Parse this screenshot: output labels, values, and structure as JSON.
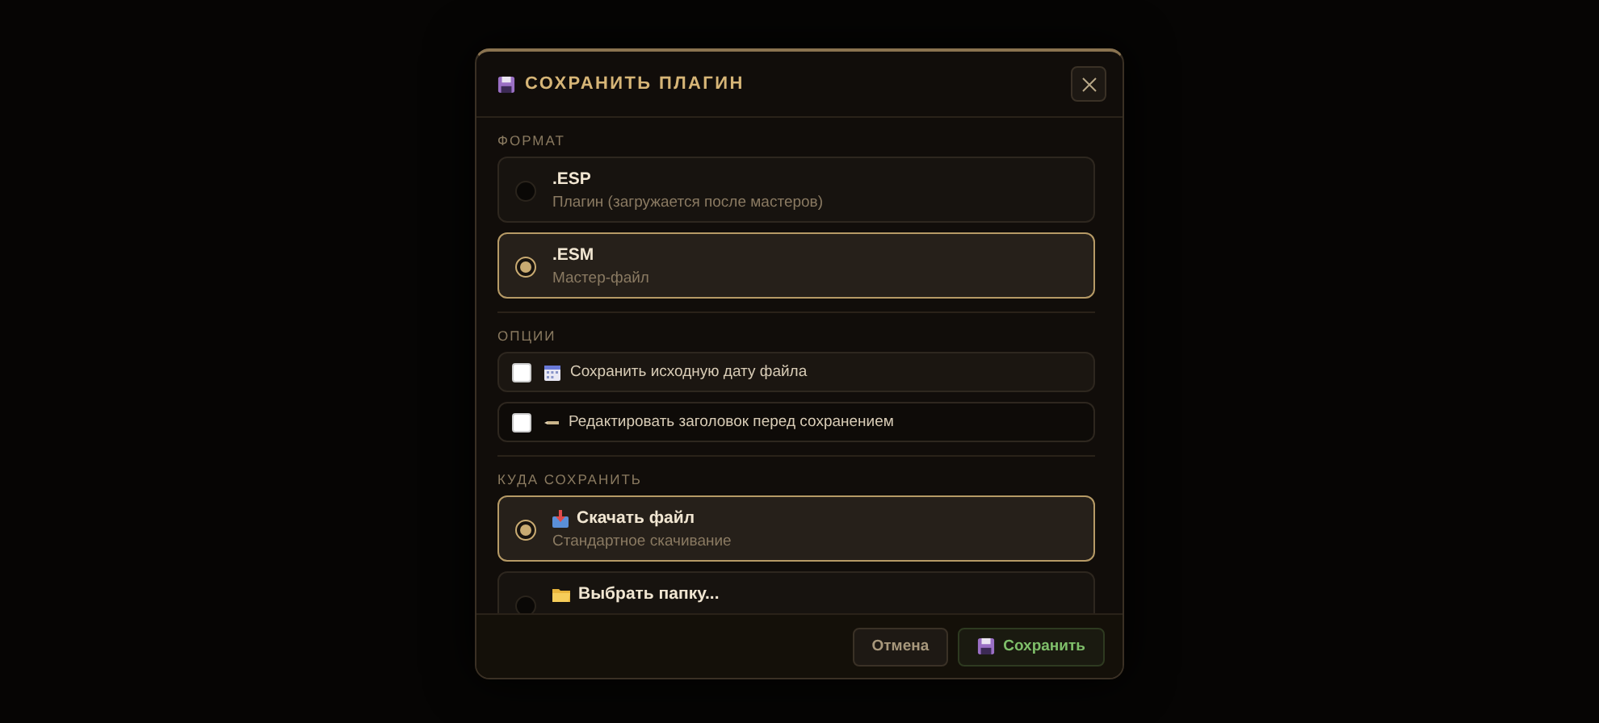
{
  "dialog": {
    "title": "СОХРАНИТЬ ПЛАГИН",
    "format": {
      "label": "ФОРМАТ",
      "options": [
        {
          "title": ".ESP",
          "description": "Плагин (загружается после мастеров)",
          "selected": false
        },
        {
          "title": ".ESM",
          "description": "Мастер-файл",
          "selected": true
        }
      ]
    },
    "options": {
      "label": "ОПЦИИ",
      "items": [
        {
          "label": "Сохранить исходную дату файла",
          "checked": false
        },
        {
          "label": "Редактировать заголовок перед сохранением",
          "checked": false
        }
      ]
    },
    "destination": {
      "label": "КУДА СОХРАНИТЬ",
      "options": [
        {
          "title": "Скачать файл",
          "description": "Стандартное скачивание",
          "selected": true
        },
        {
          "title": "Выбрать папку...",
          "selected": false
        }
      ]
    },
    "buttons": {
      "cancel": "Отмена",
      "save": "Сохранить"
    }
  }
}
